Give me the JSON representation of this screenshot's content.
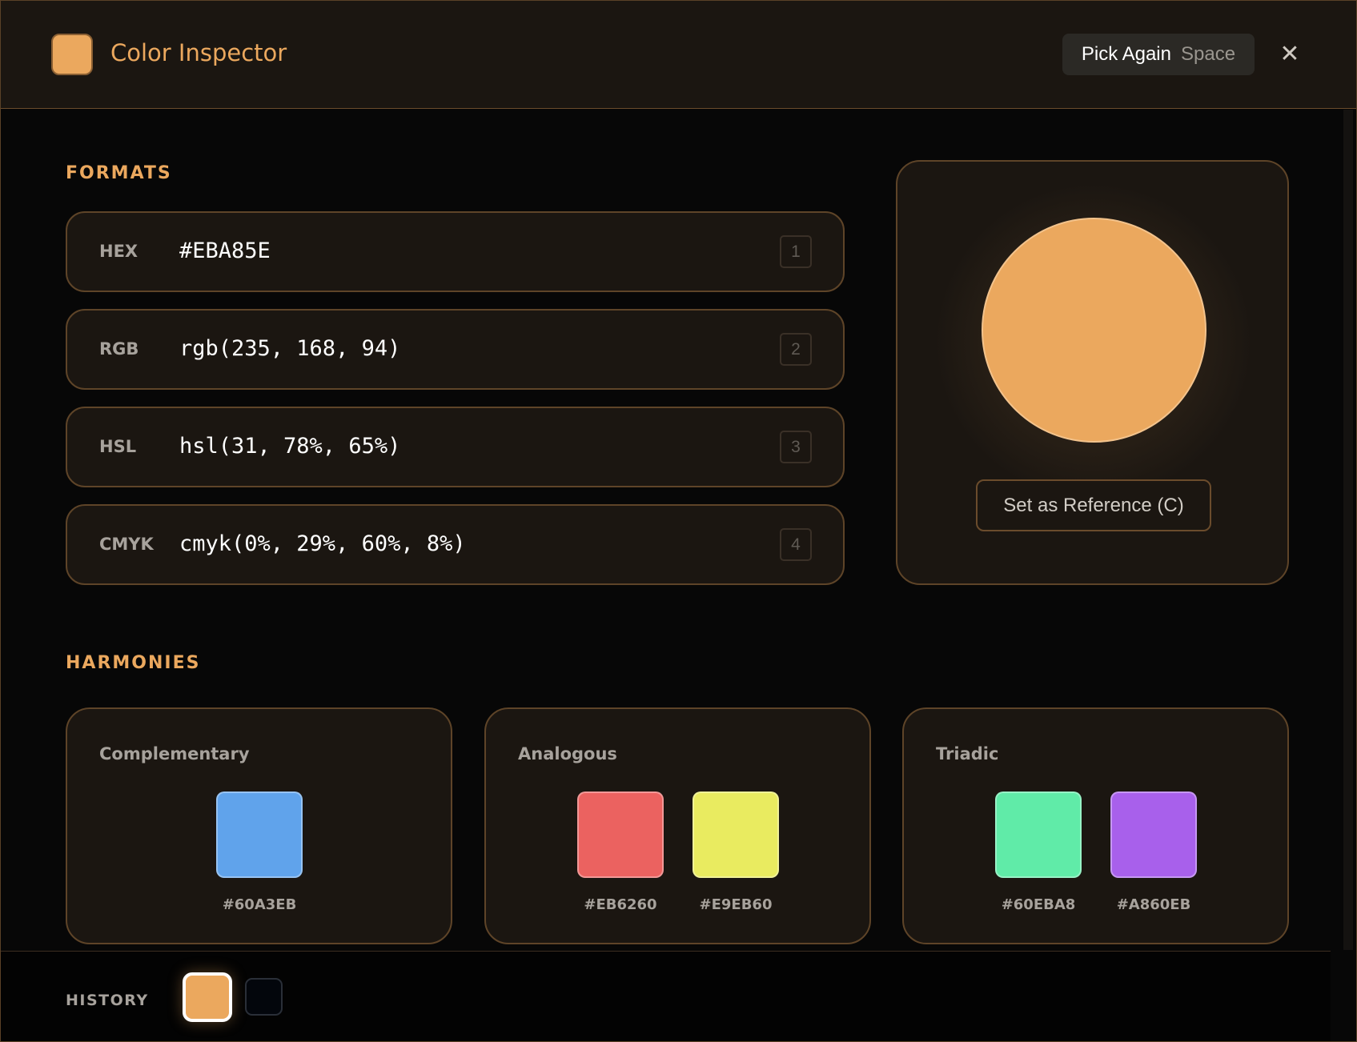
{
  "app": {
    "title": "Color Inspector",
    "current_color": "#EBA85E"
  },
  "header": {
    "pick_again_label": "Pick Again",
    "pick_again_key": "Space",
    "close_glyph": "✕"
  },
  "formats": {
    "title": "FORMATS",
    "rows": [
      {
        "label": "HEX",
        "value": "#EBA85E",
        "key": "1"
      },
      {
        "label": "RGB",
        "value": "rgb(235, 168, 94)",
        "key": "2"
      },
      {
        "label": "HSL",
        "value": "hsl(31, 78%, 65%)",
        "key": "3"
      },
      {
        "label": "CMYK",
        "value": "cmyk(0%, 29%, 60%, 8%)",
        "key": "4"
      }
    ]
  },
  "preview": {
    "color": "#EBA85E",
    "reference_button": "Set as Reference (C)"
  },
  "harmonies": {
    "title": "HARMONIES",
    "groups": [
      {
        "name": "Complementary",
        "swatches": [
          {
            "hex": "#60A3EB"
          }
        ]
      },
      {
        "name": "Analogous",
        "swatches": [
          {
            "hex": "#EB6260"
          },
          {
            "hex": "#E9EB60"
          }
        ]
      },
      {
        "name": "Triadic",
        "swatches": [
          {
            "hex": "#60EBA8"
          },
          {
            "hex": "#A860EB"
          }
        ]
      }
    ]
  },
  "history": {
    "label": "HISTORY",
    "items": [
      {
        "color": "#EBA85E",
        "active": true
      },
      {
        "color": "#03060C",
        "active": false
      }
    ]
  }
}
